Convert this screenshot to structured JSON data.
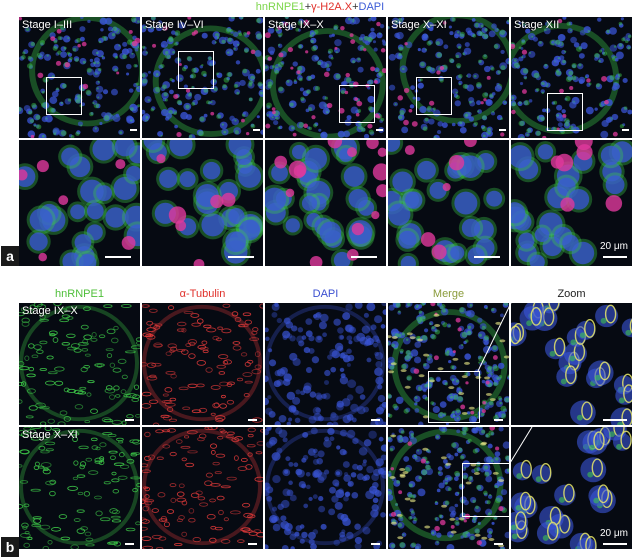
{
  "panel_a": {
    "label": "a",
    "title_parts": [
      {
        "text": "hnRNPE1",
        "color": "#7cd64a"
      },
      {
        "text": "+",
        "color": "#333333"
      },
      {
        "text": "γ-H2A.X",
        "color": "#e0302a"
      },
      {
        "text": "+",
        "color": "#333333"
      },
      {
        "text": "DAPI",
        "color": "#3b5bd6"
      }
    ],
    "stages": [
      "Stage I–III",
      "Stage IV–VI",
      "Stage IX–X",
      "Stage X–XI",
      "Stage XII"
    ],
    "scale_text": "20 μm"
  },
  "panel_b": {
    "label": "b",
    "columns": [
      {
        "text": "hnRNPE1",
        "color": "#4fbf3a"
      },
      {
        "text": "α-Tubulin",
        "color": "#e0302a"
      },
      {
        "text": "DAPI",
        "color": "#3b4fd0"
      },
      {
        "text": "Merge",
        "color": "#8a9b3a"
      },
      {
        "text": "Zoom",
        "color": "#222222"
      }
    ],
    "rows": [
      "Stage IX–X",
      "Stage X–XI"
    ],
    "scale_text": "20 μm"
  },
  "colors": {
    "green": "#3fcf4a",
    "red": "#e23a3a",
    "blue": "#3a55d8",
    "magenta": "#e0389c",
    "background": "#060a12"
  }
}
